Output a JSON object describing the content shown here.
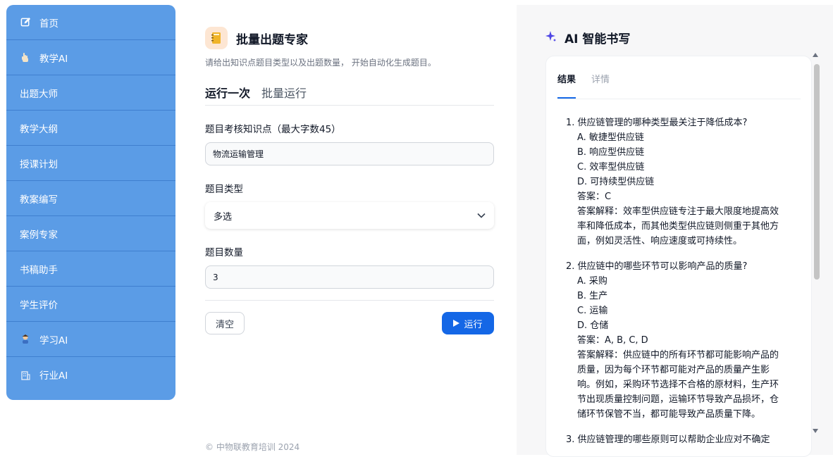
{
  "sidebar": {
    "items": [
      {
        "label": "首页",
        "icon": "edit-icon"
      },
      {
        "label": "教学AI",
        "icon": "hand-icon"
      },
      {
        "label": "出题大师",
        "icon": ""
      },
      {
        "label": "教学大纲",
        "icon": ""
      },
      {
        "label": "授课计划",
        "icon": ""
      },
      {
        "label": "教案编写",
        "icon": ""
      },
      {
        "label": "案例专家",
        "icon": ""
      },
      {
        "label": "书稿助手",
        "icon": ""
      },
      {
        "label": "学生评价",
        "icon": ""
      },
      {
        "label": "学习AI",
        "icon": "student-icon"
      },
      {
        "label": "行业AI",
        "icon": "building-icon"
      }
    ]
  },
  "main": {
    "title": "批量出题专家",
    "description": "请给出知识点题目类型以及出题数量， 开始自动化生成题目。",
    "tabs": [
      "运行一次",
      "批量运行"
    ],
    "fields": {
      "topic_label": "题目考核知识点（最大字数45）",
      "topic_value": "物流运输管理",
      "type_label": "题目类型",
      "type_value": "多选",
      "count_label": "题目数量",
      "count_value": "3"
    },
    "clear_label": "清空",
    "run_label": "运行"
  },
  "footer": "© 中物联教育培训 2024",
  "right": {
    "title": "AI 智能书写",
    "tabs": [
      "结果",
      "详情"
    ],
    "questions": [
      {
        "title": "1. 供应链管理的哪种类型最关注于降低成本?",
        "lines": [
          "A. 敏捷型供应链",
          "B. 响应型供应链",
          "C. 效率型供应链",
          "D. 可持续型供应链",
          "答案：C",
          "答案解释：效率型供应链专注于最大限度地提高效",
          "率和降低成本，而其他类型供应链则侧重于其他方",
          "面，例如灵活性、响应速度或可持续性。"
        ]
      },
      {
        "title": "2. 供应链中的哪些环节可以影响产品的质量?",
        "lines": [
          "A. 采购",
          "B. 生产",
          "C. 运输",
          "D. 仓储",
          "答案：A, B, C, D",
          "答案解释：供应链中的所有环节都可能影响产品的",
          "质量，因为每个环节都可能对产品的质量产生影",
          "响。例如，采购环节选择不合格的原材料，生产环",
          "节出现质量控制问题，运输环节导致产品损坏，仓",
          "储环节保管不当，都可能导致产品质量下降。"
        ]
      },
      {
        "title": "3. 供应链管理的哪些原则可以帮助企业应对不确定",
        "lines": []
      }
    ]
  }
}
